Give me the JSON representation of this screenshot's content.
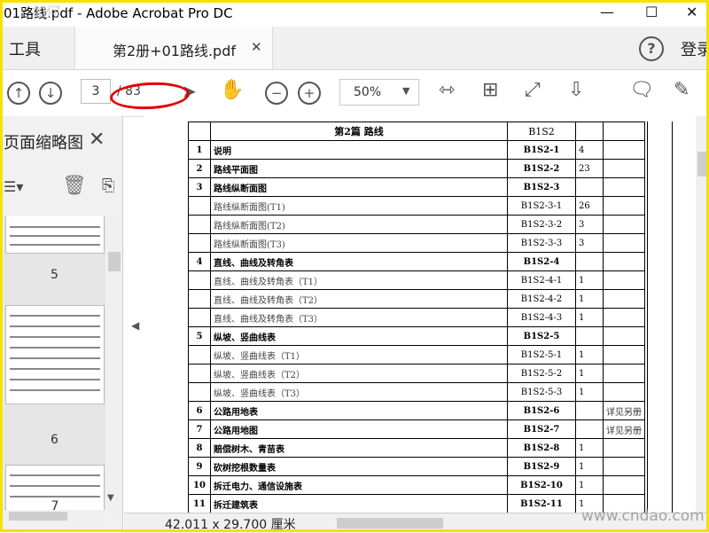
{
  "window": {
    "title": "01路线.pdf - Adobe Acrobat Pro DC",
    "top_watermark": "如何"
  },
  "tabs": {
    "tools": "工具",
    "document": "第2册+01路线.pdf",
    "login": "登录"
  },
  "toolbar": {
    "current_page": "3",
    "page_total": "/ 83",
    "zoom": "50%"
  },
  "left_panel": {
    "title": "页面缩略图",
    "thumb_numbers": [
      "5",
      "6",
      "7"
    ]
  },
  "index_table": {
    "header": {
      "title": "第2篇  路线",
      "code": "B1S2"
    },
    "rows": [
      {
        "n": "1",
        "name": "说明",
        "code": "B1S2-1",
        "pg": "4",
        "rem": "",
        "level": "main"
      },
      {
        "n": "2",
        "name": "路线平面图",
        "code": "B1S2-2",
        "pg": "23",
        "rem": "",
        "level": "main"
      },
      {
        "n": "3",
        "name": "路线纵断面图",
        "code": "B1S2-3",
        "pg": "",
        "rem": "",
        "level": "main"
      },
      {
        "n": "",
        "name": "路线纵断面图(T1)",
        "code": "B1S2-3-1",
        "pg": "26",
        "rem": "",
        "level": "sub"
      },
      {
        "n": "",
        "name": "路线纵断面图(T2)",
        "code": "B1S2-3-2",
        "pg": "3",
        "rem": "",
        "level": "sub"
      },
      {
        "n": "",
        "name": "路线纵断面图(T3)",
        "code": "B1S2-3-3",
        "pg": "3",
        "rem": "",
        "level": "sub"
      },
      {
        "n": "4",
        "name": "直线、曲线及转角表",
        "code": "B1S2-4",
        "pg": "",
        "rem": "",
        "level": "main"
      },
      {
        "n": "",
        "name": "直线、曲线及转角表（T1）",
        "code": "B1S2-4-1",
        "pg": "1",
        "rem": "",
        "level": "sub"
      },
      {
        "n": "",
        "name": "直线、曲线及转角表（T2）",
        "code": "B1S2-4-2",
        "pg": "1",
        "rem": "",
        "level": "sub"
      },
      {
        "n": "",
        "name": "直线、曲线及转角表（T3）",
        "code": "B1S2-4-3",
        "pg": "1",
        "rem": "",
        "level": "sub"
      },
      {
        "n": "5",
        "name": "纵坡、竖曲线表",
        "code": "B1S2-5",
        "pg": "",
        "rem": "",
        "level": "main"
      },
      {
        "n": "",
        "name": "纵坡、竖曲线表（T1）",
        "code": "B1S2-5-1",
        "pg": "1",
        "rem": "",
        "level": "sub"
      },
      {
        "n": "",
        "name": "纵坡、竖曲线表（T2）",
        "code": "B1S2-5-2",
        "pg": "1",
        "rem": "",
        "level": "sub"
      },
      {
        "n": "",
        "name": "纵坡、竖曲线表（T3）",
        "code": "B1S2-5-3",
        "pg": "1",
        "rem": "",
        "level": "sub"
      },
      {
        "n": "6",
        "name": "公路用地表",
        "code": "B1S2-6",
        "pg": "",
        "rem": "详见另册",
        "level": "main"
      },
      {
        "n": "7",
        "name": "公路用地图",
        "code": "B1S2-7",
        "pg": "",
        "rem": "详见另册",
        "level": "main"
      },
      {
        "n": "8",
        "name": "赔偿树木、青苗表",
        "code": "B1S2-8",
        "pg": "1",
        "rem": "",
        "level": "main"
      },
      {
        "n": "9",
        "name": "砍树挖根数量表",
        "code": "B1S2-9",
        "pg": "1",
        "rem": "",
        "level": "main"
      },
      {
        "n": "10",
        "name": "拆迁电力、通信设施表",
        "code": "B1S2-10",
        "pg": "1",
        "rem": "",
        "level": "main"
      },
      {
        "n": "11",
        "name": "拆迁建筑表",
        "code": "B1S2-11",
        "pg": "1",
        "rem": "",
        "level": "main"
      }
    ]
  },
  "status_bar": {
    "dimensions": "42.011 x 29.700 厘米"
  },
  "watermark": "www.cndao.com",
  "colors": {
    "highlight": "#e30000",
    "frame": "#f5e000",
    "hand_tool": "#1a73c9"
  }
}
